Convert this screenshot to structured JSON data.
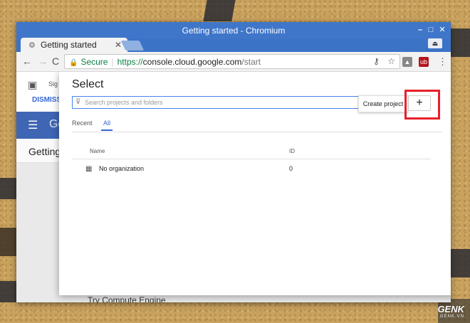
{
  "window": {
    "title": "Getting started - Chromium",
    "min": "–",
    "max": "□",
    "close": "✕"
  },
  "tab": {
    "icon": "⚙",
    "title": "Getting started",
    "close": "✕"
  },
  "user_btn": "⏏",
  "toolbar": {
    "back": "←",
    "forward": "→",
    "reload": "C",
    "lock": "🔒",
    "secure": "Secure",
    "scheme": "https://",
    "host": "console.cloud.google.com",
    "path": "/start",
    "key": "⚷",
    "star": "☆",
    "ext1": "▲",
    "ext2": "ub",
    "menu": "⋮"
  },
  "background_page": {
    "gift": "▣",
    "sign": "Sig",
    "dismiss": "DISMISS",
    "burger": "☰",
    "logo_partial": "Go",
    "heading": "Getting",
    "bottom_text": "Try Compute Engine"
  },
  "dialog": {
    "title": "Select",
    "filter": "⊽",
    "search_placeholder": "Search projects and folders",
    "create_tooltip": "Create project",
    "plus": "+",
    "tab_recent": "Recent",
    "tab_all": "All",
    "col_name": "Name",
    "col_id": "ID",
    "row_icon": "▦",
    "row_name": "No organization",
    "row_id": "0"
  },
  "watermark": {
    "brand": "GENK",
    "sub": "GENK.VN"
  },
  "colors": {
    "accent": "#3367d6",
    "highlight": "#e8202a",
    "titlebar": "#3f76c9",
    "secure": "#0b8043"
  }
}
